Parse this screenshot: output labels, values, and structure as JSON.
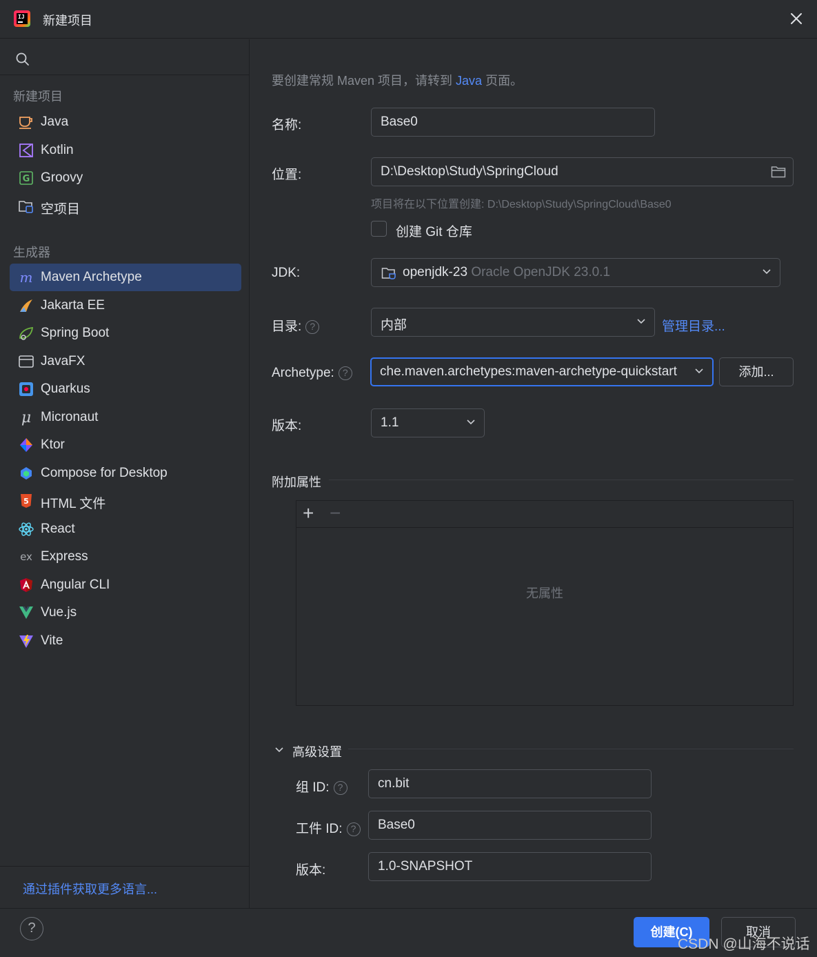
{
  "window": {
    "title": "新建项目"
  },
  "sidebar": {
    "section_new": "新建项目",
    "new_items": [
      {
        "label": "Java",
        "icon": "java-cup-icon"
      },
      {
        "label": "Kotlin",
        "icon": "kotlin-icon"
      },
      {
        "label": "Groovy",
        "icon": "groovy-icon"
      },
      {
        "label": "空项目",
        "icon": "empty-project-icon"
      }
    ],
    "section_generators": "生成器",
    "generator_items": [
      {
        "label": "Maven Archetype",
        "icon": "maven-icon",
        "selected": true
      },
      {
        "label": "Jakarta EE",
        "icon": "jakarta-icon"
      },
      {
        "label": "Spring Boot",
        "icon": "spring-icon"
      },
      {
        "label": "JavaFX",
        "icon": "javafx-icon"
      },
      {
        "label": "Quarkus",
        "icon": "quarkus-icon"
      },
      {
        "label": "Micronaut",
        "icon": "micronaut-icon"
      },
      {
        "label": "Ktor",
        "icon": "ktor-icon"
      },
      {
        "label": "Compose for Desktop",
        "icon": "compose-icon"
      },
      {
        "label": "HTML 文件",
        "icon": "html5-icon"
      },
      {
        "label": "React",
        "icon": "react-icon"
      },
      {
        "label": "Express",
        "icon": "express-icon"
      },
      {
        "label": "Angular CLI",
        "icon": "angular-icon"
      },
      {
        "label": "Vue.js",
        "icon": "vue-icon"
      },
      {
        "label": "Vite",
        "icon": "vite-icon"
      }
    ],
    "plugins_link": "通过插件获取更多语言..."
  },
  "form": {
    "hint_prefix": "要创建常规 Maven 项目，请转到",
    "hint_link": "Java",
    "hint_suffix": "页面。",
    "name_label": "名称:",
    "name_value": "Base0",
    "location_label": "位置:",
    "location_value": "D:\\Desktop\\Study\\SpringCloud",
    "location_hint": "项目将在以下位置创建: D:\\Desktop\\Study\\SpringCloud\\Base0",
    "git_label": "创建 Git 仓库",
    "git_checked": false,
    "jdk_label": "JDK:",
    "jdk_name": "openjdk-23",
    "jdk_detail": "Oracle OpenJDK 23.0.1",
    "catalog_label": "目录:",
    "catalog_value": "内部",
    "catalog_manage_link": "管理目录...",
    "archetype_label": "Archetype:",
    "archetype_value": "che.maven.archetypes:maven-archetype-quickstart",
    "archetype_add_button": "添加...",
    "version_label": "版本:",
    "version_value": "1.1",
    "properties_title": "附加属性",
    "properties_add": "+",
    "properties_remove": "−",
    "properties_empty": "无属性",
    "advanced_title": "高级设置",
    "group_id_label": "组 ID:",
    "group_id_value": "cn.bit",
    "artifact_id_label": "工件 ID:",
    "artifact_id_value": "Base0",
    "adv_version_label": "版本:",
    "adv_version_value": "1.0-SNAPSHOT"
  },
  "footer": {
    "help": "?",
    "create_button": "创建(C)",
    "cancel_button": "取消"
  },
  "watermark": "CSDN @山海不说话",
  "colors": {
    "accent": "#3574f0",
    "link": "#548af7",
    "background": "#2b2d30",
    "selection": "#2e436e"
  }
}
